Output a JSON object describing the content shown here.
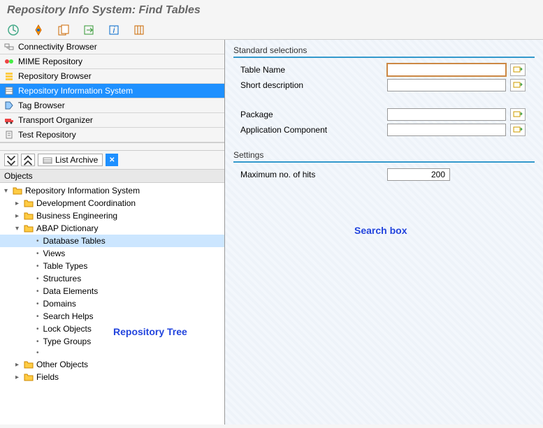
{
  "title": "Repository Info System: Find Tables",
  "nav": [
    {
      "label": "Connectivity Browser",
      "icon": "connectivity"
    },
    {
      "label": "MIME Repository",
      "icon": "mime"
    },
    {
      "label": "Repository Browser",
      "icon": "browser"
    },
    {
      "label": "Repository Information System",
      "icon": "info",
      "selected": true
    },
    {
      "label": "Tag Browser",
      "icon": "tag"
    },
    {
      "label": "Transport Organizer",
      "icon": "transport"
    },
    {
      "label": "Test Repository",
      "icon": "test"
    }
  ],
  "listArchive": "List Archive",
  "objectsHeader": "Objects",
  "tree": {
    "root": "Repository Information System",
    "children": [
      {
        "label": "Development Coordination",
        "type": "folder",
        "expanded": false
      },
      {
        "label": "Business Engineering",
        "type": "folder",
        "expanded": false
      },
      {
        "label": "ABAP Dictionary",
        "type": "folder",
        "expanded": true,
        "children": [
          {
            "label": "Database Tables",
            "selected": true
          },
          {
            "label": "Views"
          },
          {
            "label": "Table Types"
          },
          {
            "label": "Structures"
          },
          {
            "label": "Data Elements"
          },
          {
            "label": "Domains"
          },
          {
            "label": "Search Helps"
          },
          {
            "label": "Lock Objects"
          },
          {
            "label": "Type Groups"
          },
          {
            "label": ""
          }
        ]
      },
      {
        "label": "Other Objects",
        "type": "folder",
        "expanded": false
      },
      {
        "label": "Fields",
        "type": "folder",
        "expanded": false
      }
    ]
  },
  "standardSelections": {
    "title": "Standard selections",
    "fields": [
      {
        "label": "Table Name",
        "value": "",
        "focus": true
      },
      {
        "label": "Short description",
        "value": ""
      },
      {
        "label": "Package",
        "value": ""
      },
      {
        "label": "Application Component",
        "value": ""
      }
    ]
  },
  "settings": {
    "title": "Settings",
    "maxHitsLabel": "Maximum no. of hits",
    "maxHitsValue": "200"
  },
  "annotations": {
    "searchBox": "Search box",
    "repoTree": "Repository Tree"
  }
}
